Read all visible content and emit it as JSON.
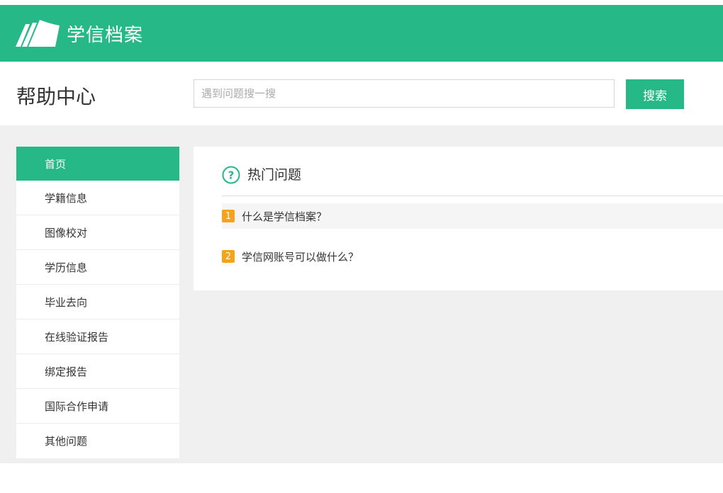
{
  "header": {
    "logo_text": "学信档案",
    "brand_color": "#26b886"
  },
  "subheader": {
    "title": "帮助中心",
    "search_placeholder": "遇到问题搜一搜",
    "search_button": "搜索"
  },
  "sidebar": {
    "items": [
      {
        "label": "首页",
        "active": true
      },
      {
        "label": "学籍信息"
      },
      {
        "label": "图像校对"
      },
      {
        "label": "学历信息"
      },
      {
        "label": "毕业去向"
      },
      {
        "label": "在线验证报告"
      },
      {
        "label": "绑定报告"
      },
      {
        "label": "国际合作申请"
      },
      {
        "label": "其他问题"
      }
    ]
  },
  "hot": {
    "title": "热门问题",
    "icon": "question-circle-icon",
    "items": [
      {
        "num": "1",
        "text": "什么是学信档案？"
      },
      {
        "num": "2",
        "text": "学信网账号可以做什么？"
      }
    ]
  },
  "colors": {
    "accent": "#26b886",
    "badge": "#f7a21b",
    "background": "#f0f0f0"
  }
}
